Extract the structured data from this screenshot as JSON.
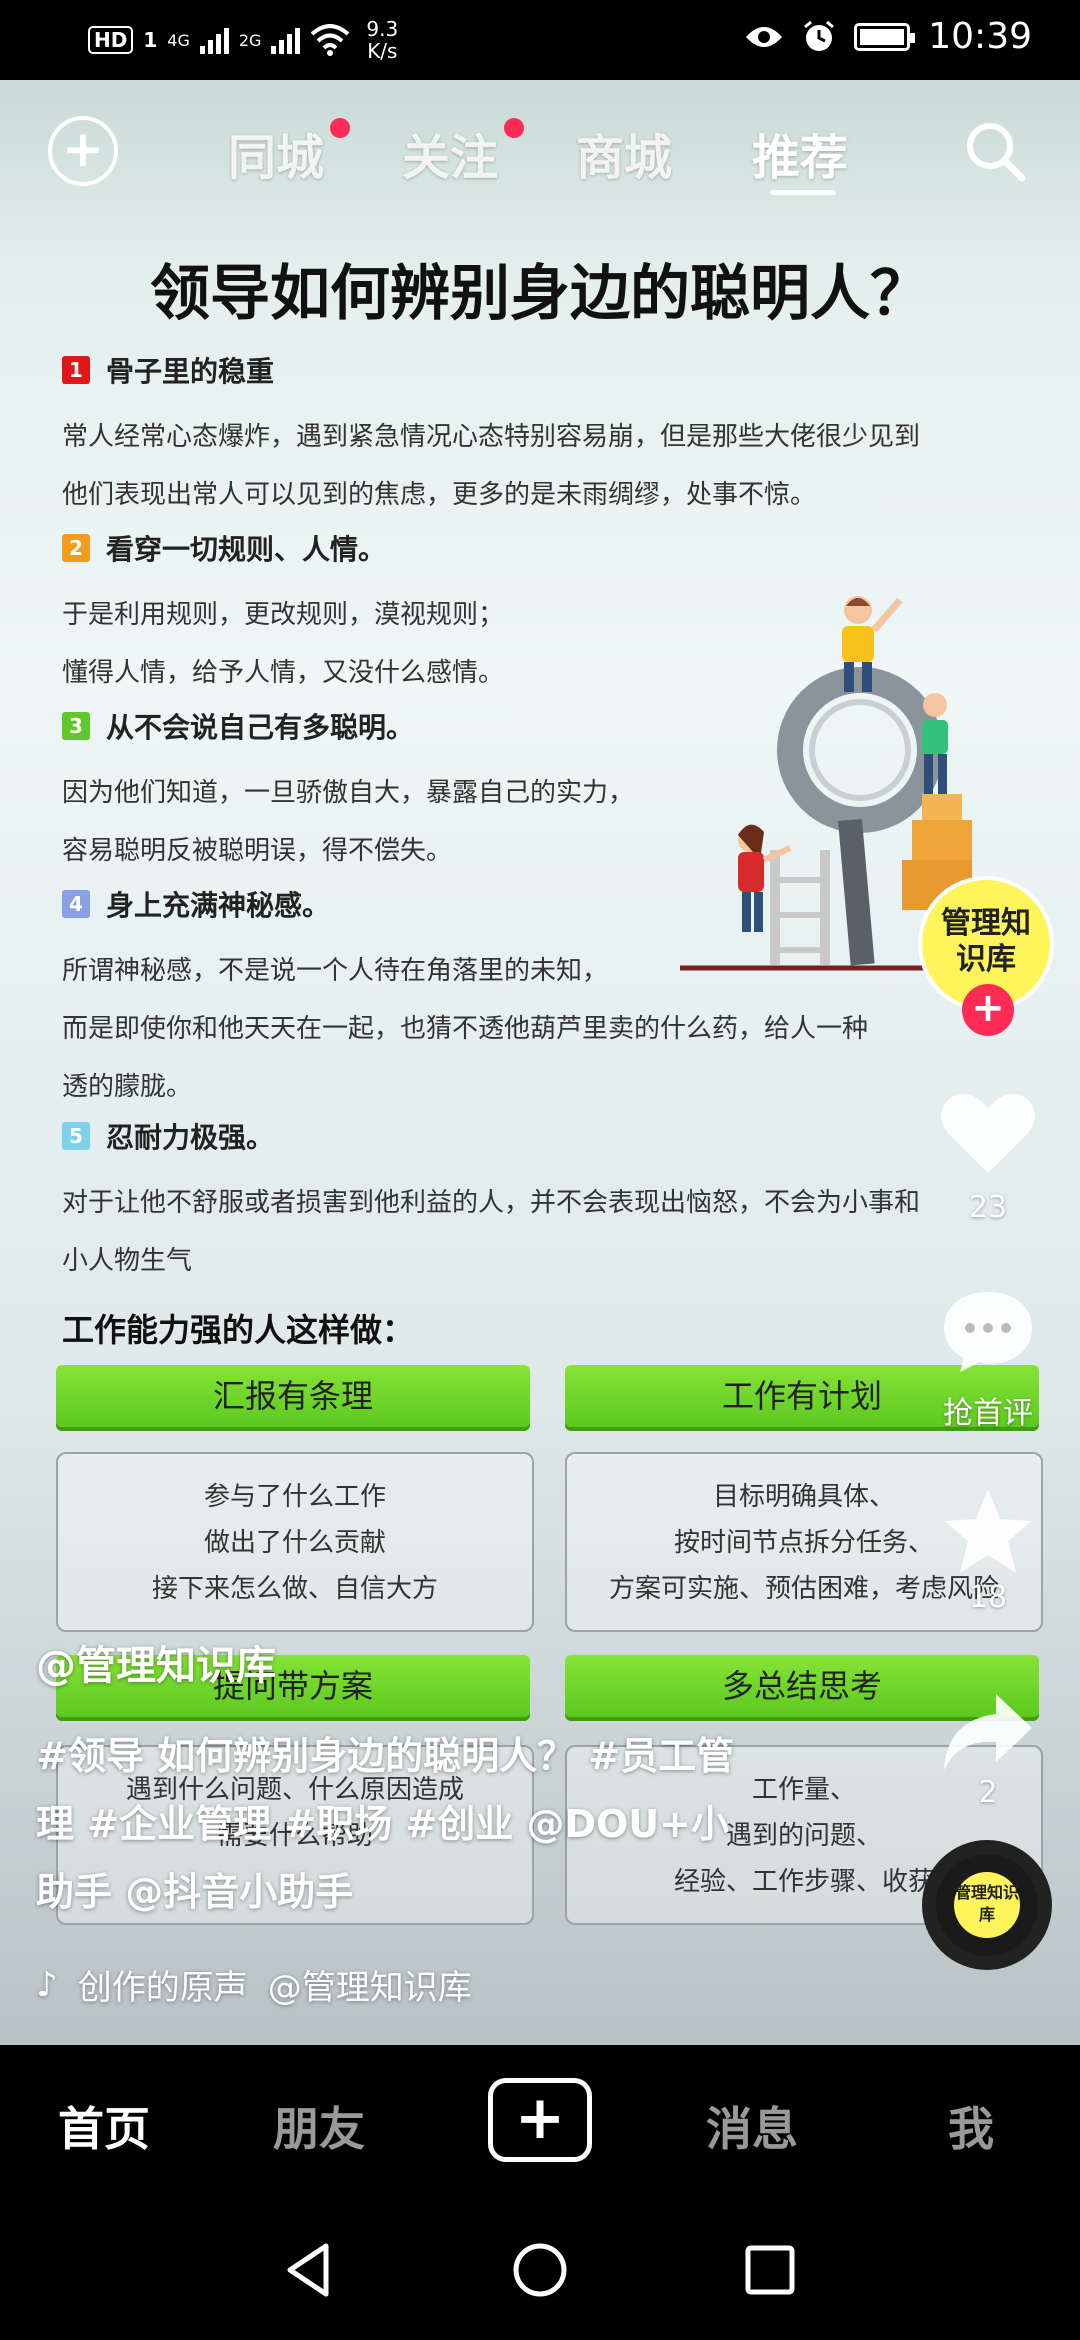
{
  "status_bar": {
    "hd": "HD",
    "sim1": "1",
    "net1": "4G",
    "net2": "2G",
    "speed_value": "9.3",
    "speed_unit": "K/s",
    "time": "10:39"
  },
  "top_nav": {
    "tabs": [
      {
        "label": "同城",
        "dot": true
      },
      {
        "label": "关注",
        "dot": true
      },
      {
        "label": "商城",
        "dot": false
      },
      {
        "label": "推荐",
        "dot": false
      }
    ],
    "active_tab": "推荐"
  },
  "poster": {
    "title": "领导如何辨别身边的聪明人？",
    "sections": [
      {
        "num": "1",
        "color": "#e0161b",
        "heading": "骨子里的稳重",
        "lines": [
          "常人经常心态爆炸，遇到紧急情况心态特别容易崩，但是那些大佬很少见到",
          "他们表现出常人可以见到的焦虑，更多的是未雨绸缪，处事不惊。"
        ]
      },
      {
        "num": "2",
        "color": "#f39b1a",
        "heading": "看穿一切规则、人情。",
        "lines": [
          "于是利用规则，更改规则，漠视规则；",
          "懂得人情，给予人情，又没什么感情。"
        ]
      },
      {
        "num": "3",
        "color": "#5fc72b",
        "heading": "从不会说自己有多聪明。",
        "lines": [
          "因为他们知道，一旦骄傲自大，暴露自己的实力，",
          "容易聪明反被聪明误，得不偿失。"
        ]
      },
      {
        "num": "4",
        "color": "#8aa0e6",
        "heading": "身上充满神秘感。",
        "lines": [
          "所谓神秘感，不是说一个人待在角落里的未知，",
          "而是即使你和他天天在一起，也猜不透他葫芦里卖的什么药，给人一种",
          "透的朦胧。"
        ]
      },
      {
        "num": "5",
        "color": "#7fd0ea",
        "heading": "忍耐力极强。",
        "lines": [
          "对于让他不舒服或者损害到他利益的人，并不会表现出恼怒，不会为小事和",
          "小人物生气"
        ]
      }
    ],
    "work_title": "工作能力强的人这样做：",
    "cards": [
      {
        "label": "汇报有条理",
        "lines": [
          "参与了什么工作",
          "做出了什么贡献",
          "接下来怎么做、自信大方"
        ]
      },
      {
        "label": "工作有计划",
        "lines": [
          "目标明确具体、",
          "按时间节点拆分任务、",
          "方案可实施、预估困难，考虑风险"
        ]
      },
      {
        "label": "提问带方案",
        "lines": [
          "遇到什么问题、什么原因造成",
          "需要什么帮助",
          ""
        ]
      },
      {
        "label": "多总结思考",
        "lines": [
          "工作量、",
          "遇到的问题、",
          "经验、工作步骤、收获"
        ]
      }
    ]
  },
  "right_rail": {
    "avatar_text": "管理知识库",
    "likes": "23",
    "comments": "抢首评",
    "favorites": "18",
    "shares": "2",
    "disc_text": "管理知识库"
  },
  "caption": {
    "author": "@管理知识库",
    "description": "#领导 如何辨别身边的聪明人？ #员工管理 #企业管理 #职场 #创业 @DOU+小助手 @抖音小助手",
    "music": "创作的原声",
    "music_author": "@管理知识库"
  },
  "bottom_tabs": {
    "items": [
      "首页",
      "朋友",
      "消息",
      "我"
    ],
    "active": "首页"
  }
}
